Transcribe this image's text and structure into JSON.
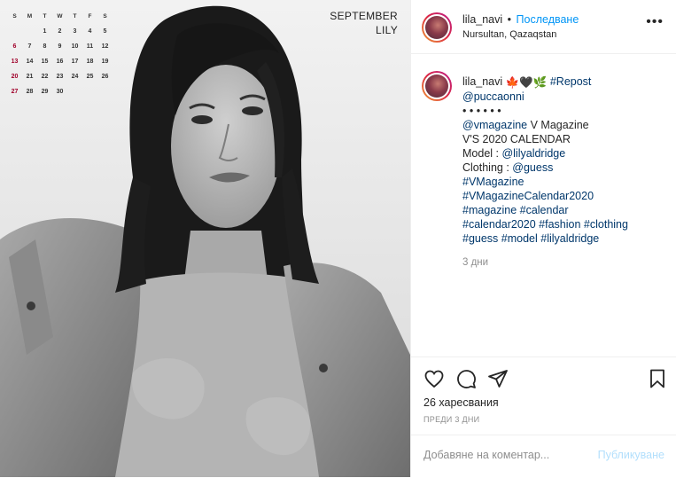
{
  "calendar": {
    "weekdays": [
      "S",
      "M",
      "T",
      "W",
      "T",
      "F",
      "S"
    ],
    "weeks": [
      [
        "",
        "",
        "1",
        "2",
        "3",
        "4",
        "5"
      ],
      [
        "6",
        "7",
        "8",
        "9",
        "10",
        "11",
        "12"
      ],
      [
        "13",
        "14",
        "15",
        "16",
        "17",
        "18",
        "19"
      ],
      [
        "20",
        "21",
        "22",
        "23",
        "24",
        "25",
        "26"
      ],
      [
        "27",
        "28",
        "29",
        "30",
        "",
        "",
        ""
      ]
    ],
    "month": "SEPTEMBER",
    "name": "LILY"
  },
  "header": {
    "username": "lila_navi",
    "separator": "•",
    "follow_label": "Последване",
    "location": "Nursultan, Qazaqstan",
    "more_label": "•••"
  },
  "caption": {
    "username": "lila_navi",
    "emojis": "🍁🖤🌿",
    "repost_tag": "#Repost",
    "mention": "@puccaonni",
    "dots": "• • • • • •",
    "line_vmag_handle": "@vmagazine",
    "line_vmag_text": " V Magazine",
    "line_calendar": "V'S 2020 CALENDAR",
    "model_prefix": "Model : ",
    "model_handle": "@lilyaldridge",
    "clothing_prefix": "Clothing : ",
    "clothing_handle": "@guess",
    "tags_1": "#VMagazine",
    "tags_2": "#VMagazineCalendar2020",
    "tags_3": "#magazine #calendar",
    "tags_4": "#calendar2020 #fashion #clothing",
    "tags_5": "#guess #model #lilyaldridge",
    "time": "3 дни"
  },
  "actions": {
    "likes": "26 харесвания",
    "posted_ago": "ПРЕДИ 3 ДНИ"
  },
  "comment": {
    "placeholder": "Добавяне на коментар...",
    "post_label": "Публикуване"
  },
  "colors": {
    "link": "#00376b",
    "follow": "#0095f6",
    "muted": "#8e8e8e",
    "post_disabled": "#b2dffc",
    "calendar_sunday": "#a0002a"
  }
}
